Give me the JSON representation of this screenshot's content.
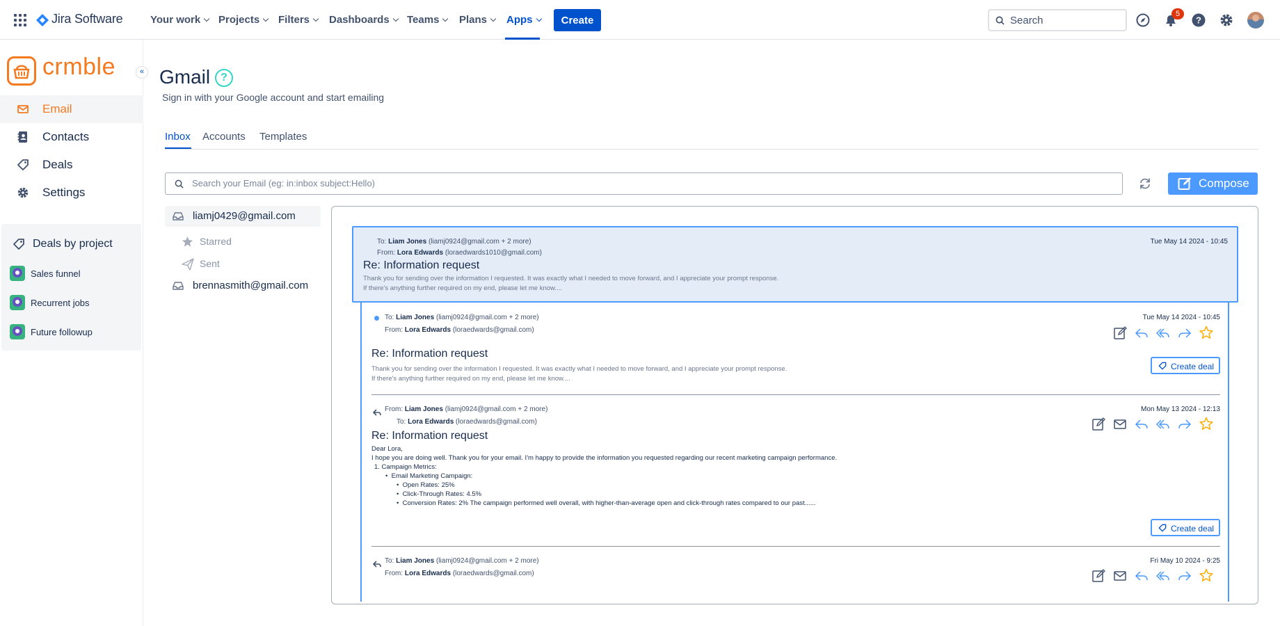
{
  "topnav": {
    "app_name": "Jira Software",
    "items": [
      {
        "label": "Your work",
        "active": false
      },
      {
        "label": "Projects",
        "active": false
      },
      {
        "label": "Filters",
        "active": false
      },
      {
        "label": "Dashboards",
        "active": false
      },
      {
        "label": "Teams",
        "active": false
      },
      {
        "label": "Plans",
        "active": false
      },
      {
        "label": "Apps",
        "active": true
      }
    ],
    "create_label": "Create",
    "search_placeholder": "Search",
    "notification_count": "5",
    "icons": [
      "compass-icon",
      "bell-icon",
      "help-icon",
      "gear-icon",
      "avatar"
    ],
    "accent": "#0052CC"
  },
  "sidebar": {
    "brand": "crmble",
    "brand_color": "#F47A20",
    "collapse_symbol": "«",
    "items": [
      {
        "label": "Email",
        "icon": "mail-icon",
        "active": true
      },
      {
        "label": "Contacts",
        "icon": "contact-book-icon",
        "active": false
      },
      {
        "label": "Deals",
        "icon": "tag-icon",
        "active": false
      },
      {
        "label": "Settings",
        "icon": "gear-icon",
        "active": false
      }
    ],
    "deals_panel": {
      "title": "Deals by project",
      "projects": [
        "Sales funnel",
        "Recurrent jobs",
        "Future followup"
      ]
    }
  },
  "main": {
    "title": "Gmail",
    "help_symbol": "?",
    "subtitle": "Sign in with your Google account and start emailing",
    "tabs": [
      {
        "label": "Inbox",
        "active": true
      },
      {
        "label": "Accounts",
        "active": false
      },
      {
        "label": "Templates",
        "active": false
      }
    ],
    "search_placeholder": "Search your Email (eg: in:inbox subject:Hello)",
    "compose_label": "Compose",
    "accounts": [
      {
        "email": "liamj0429@gmail.com",
        "selected": true,
        "folders": [
          "Starred",
          "Sent"
        ]
      },
      {
        "email": "brennasmith@gmail.com",
        "selected": false,
        "folders": []
      }
    ]
  },
  "thread": {
    "to_name": "Liam Jones",
    "to_detail": "(liamj0924@gmail.com + 2 more)",
    "from_name": "Lora Edwards",
    "from_detail": "(loraedwards1010@gmail.com)",
    "date": "Tue May 14 2024 - 10:45",
    "subject": "Re: Information request",
    "preview_1": "Thank you for sending over the information I requested. It was exactly what I needed to move forward, and I appreciate your prompt response.",
    "preview_2": "If there's anything further required on my end, please let me know...."
  },
  "messages": [
    {
      "line1_prefix": "To:",
      "line1_name": "Liam Jones",
      "line1_detail": "(liamj0924@gmail.com + 2 more)",
      "line2_prefix": "From:",
      "line2_name": "Lora Edwards",
      "line2_detail": "(loraedwards@gmail.com)",
      "date": "Tue May 14 2024 - 10:45",
      "subject": "Re: Information request",
      "body": [
        "Thank you for sending over the information I requested. It was exactly what I needed to move forward, and I appreciate your prompt response.",
        "If there's anything further required on my end, please let me know...."
      ],
      "deal_label": "Create deal",
      "unread": true
    },
    {
      "line1_prefix": "From:",
      "line1_name": "Liam Jones",
      "line1_detail": "(liamj0924@gmail.com + 2 more)",
      "line2_prefix": "To:",
      "line2_name": "Lora Edwards",
      "line2_detail": "(loraedwards@gmail.com)",
      "date": "Mon May 13 2024 - 12:13",
      "subject": "Re: Information request",
      "body": [
        "Dear Lora,",
        "I hope you are doing well. Thank you for your email. I'm happy to provide the information you requested regarding our recent marketing campaign performance.",
        "1. Campaign Metrics:",
        "Email Marketing Campaign:",
        "Open Rates: 25%",
        "Click-Through Rates: 4.5%",
        "Conversion Rates: 2% The campaign performed well overall, with higher-than-average open and click-through rates compared to our past......"
      ],
      "deal_label": "Create deal"
    },
    {
      "line1_prefix": "To:",
      "line1_name": "Liam Jones",
      "line1_detail": "(liamj0924@gmail.com + 2 more)",
      "line2_prefix": "From:",
      "line2_name": "Lora Edwards",
      "line2_detail": "(loraedwards@gmail.com)",
      "date": "Fri May 10 2024 - 9:25"
    }
  ]
}
